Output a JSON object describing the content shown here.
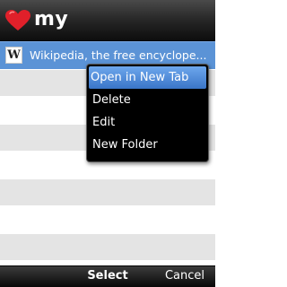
{
  "titlebar": {
    "title": "my"
  },
  "list": {
    "selected_item": {
      "icon": "wikipedia-icon",
      "icon_glyph": "W",
      "label": "Wikipedia, the free encyclope..."
    }
  },
  "context_menu": {
    "items": [
      {
        "label": "Open in New Tab"
      },
      {
        "label": "Delete"
      },
      {
        "label": "Edit"
      },
      {
        "label": "New Folder"
      }
    ]
  },
  "softkeys": {
    "center_label": "Select",
    "right_label": "Cancel"
  },
  "colors": {
    "selection_blue": "#5b93d6",
    "menu_highlight": "#3a75c8",
    "heart_red": "#e0202a",
    "row_alt_gray": "#e4e4e4"
  }
}
